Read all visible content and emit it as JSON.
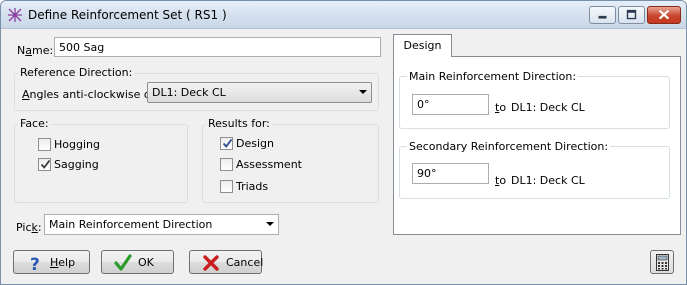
{
  "window": {
    "title": "Define Reinforcement Set ( RS1 )",
    "accent": "#c4391f"
  },
  "name": {
    "label_pre": "N",
    "label_mnemonic": "a",
    "label_post": "me:",
    "value": "500 Sag"
  },
  "reference_direction": {
    "title": "Reference Direction:",
    "angles_label_mnemonic": "A",
    "angles_label_rest": "ngles anti-clockwise of:",
    "selected": "DL1: Deck CL"
  },
  "face": {
    "title": "Face:",
    "options": [
      {
        "label": "Hogging",
        "checked": false
      },
      {
        "label": "Sagging",
        "checked": true
      }
    ]
  },
  "results_for": {
    "title": "Results for:",
    "options": [
      {
        "label": "Design",
        "checked": true
      },
      {
        "label": "Assessment",
        "checked": false
      },
      {
        "label": "Triads",
        "checked": false
      }
    ]
  },
  "pick": {
    "label_pre": "Pic",
    "label_mnemonic": "k",
    "label_post": ":",
    "selected": "Main Reinforcement Direction"
  },
  "tabs": [
    {
      "label": "Design",
      "active": true
    }
  ],
  "design": {
    "main": {
      "title": "Main Reinforcement Direction:",
      "value": "0°",
      "to_mnemonic": "t",
      "to_rest": "o",
      "reference": "DL1: Deck CL"
    },
    "secondary": {
      "title": "Secondary Reinforcement Direction:",
      "value": "90°",
      "to_mnemonic": "t",
      "to_rest": "o",
      "reference": "DL1: Deck CL"
    }
  },
  "buttons": {
    "help": {
      "mnemonic": "H",
      "rest": "elp",
      "icon": "help-question-icon"
    },
    "ok": {
      "label": "OK",
      "icon": "green-check-icon"
    },
    "cancel": {
      "label": "Cancel",
      "icon": "red-x-icon"
    },
    "calculator": {
      "icon": "calculator-icon"
    }
  }
}
